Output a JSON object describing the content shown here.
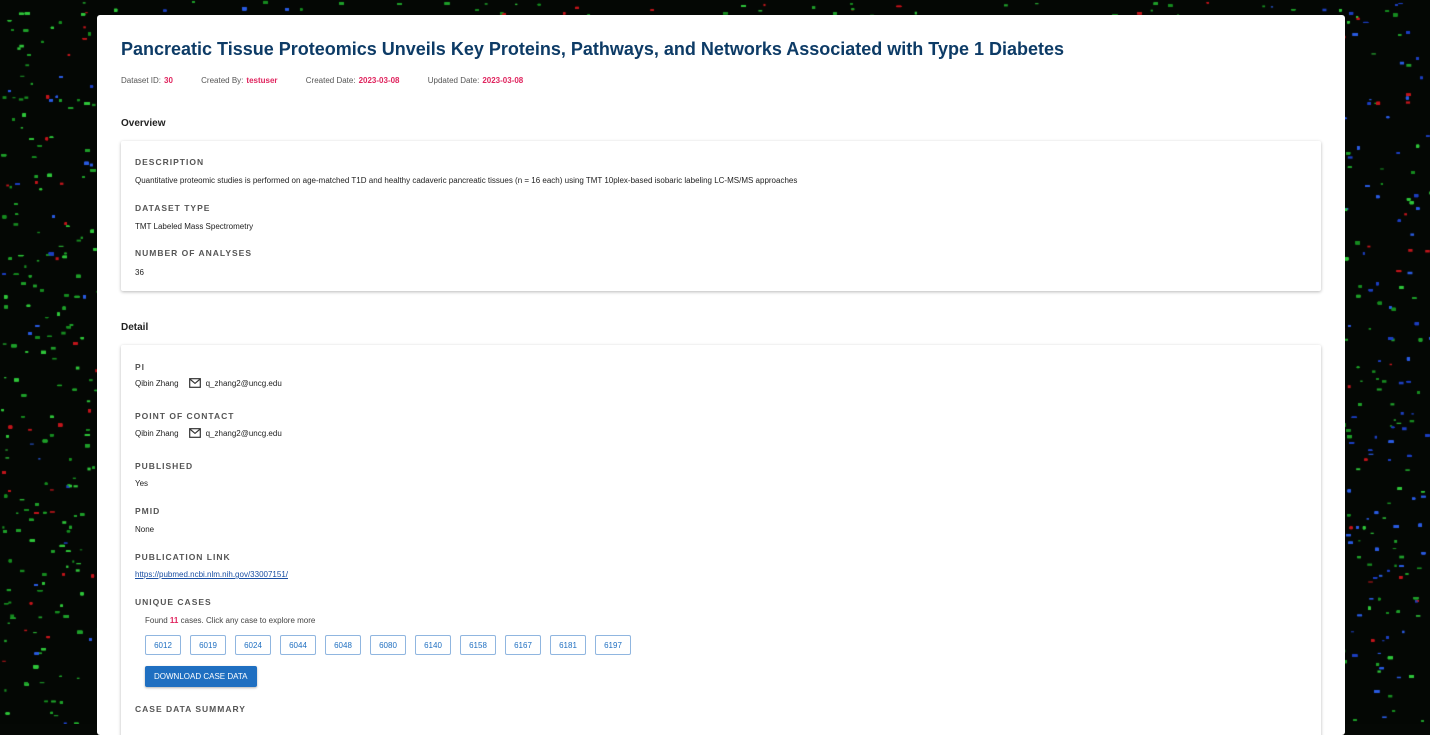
{
  "header": {
    "title": "Pancreatic Tissue Proteomics Unveils Key Proteins, Pathways, and Networks Associated with Type 1 Diabetes",
    "meta": [
      {
        "label": "Dataset ID:",
        "value": "30"
      },
      {
        "label": "Created By:",
        "value": "testuser"
      },
      {
        "label": "Created Date:",
        "value": "2023-03-08"
      },
      {
        "label": "Updated Date:",
        "value": "2023-03-08"
      }
    ]
  },
  "overview": {
    "heading": "Overview",
    "description_label": "DESCRIPTION",
    "description": "Quantitative proteomic studies is performed on age-matched T1D and healthy cadaveric pancreatic tissues (n = 16 each) using TMT 10plex-based isobaric labeling LC-MS/MS approaches",
    "dataset_type_label": "DATASET TYPE",
    "dataset_type": "TMT Labeled Mass Spectrometry",
    "num_analyses_label": "NUMBER OF ANALYSES",
    "num_analyses": "36"
  },
  "detail": {
    "heading": "Detail",
    "pi_label": "PI",
    "pi_name": "Qibin Zhang",
    "pi_email": "q_zhang2@uncg.edu",
    "poc_label": "POINT OF CONTACT",
    "poc_name": "Qibin Zhang",
    "poc_email": "q_zhang2@uncg.edu",
    "published_label": "PUBLISHED",
    "published": "Yes",
    "pmid_label": "PMID",
    "pmid": "None",
    "publication_link_label": "PUBLICATION LINK",
    "publication_link": "https://pubmed.ncbi.nlm.nih.gov/33007151/",
    "unique_cases_label": "UNIQUE CASES",
    "found_prefix": "Found",
    "found_count": "11",
    "found_suffix": "cases. Click any case to explore more",
    "cases": [
      "6012",
      "6019",
      "6024",
      "6044",
      "6048",
      "6080",
      "6140",
      "6158",
      "6167",
      "6181",
      "6197"
    ],
    "download_label": "DOWNLOAD CASE DATA",
    "case_summary_label": "CASE DATA SUMMARY"
  },
  "colors": {
    "title": "#0d3b66",
    "accent": "#e0245e",
    "button": "#1f6fc1"
  },
  "icons": {
    "email": "mail-icon"
  }
}
